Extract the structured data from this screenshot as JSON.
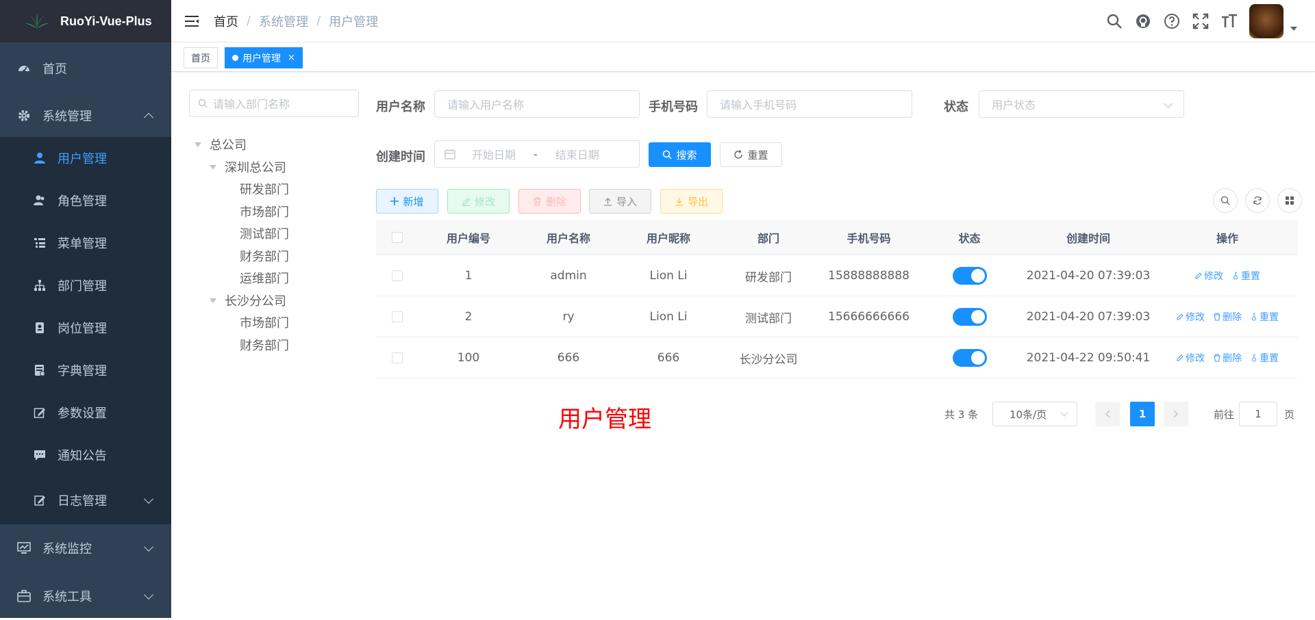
{
  "app": {
    "name": "RuoYi-Vue-Plus"
  },
  "sidebar": {
    "items": [
      {
        "label": "首页",
        "icon": "dashboard-icon"
      },
      {
        "label": "系统管理",
        "icon": "gear-icon",
        "expanded": true
      }
    ],
    "system_sub": [
      {
        "label": "用户管理",
        "icon": "user-icon",
        "active": true
      },
      {
        "label": "角色管理",
        "icon": "peoples-icon"
      },
      {
        "label": "菜单管理",
        "icon": "tree-table-icon"
      },
      {
        "label": "部门管理",
        "icon": "tree-icon"
      },
      {
        "label": "岗位管理",
        "icon": "post-icon"
      },
      {
        "label": "字典管理",
        "icon": "dict-icon"
      },
      {
        "label": "参数设置",
        "icon": "edit-icon"
      },
      {
        "label": "通知公告",
        "icon": "message-icon"
      },
      {
        "label": "日志管理",
        "icon": "log-icon"
      }
    ],
    "bottom": [
      {
        "label": "系统监控",
        "icon": "monitor-icon"
      },
      {
        "label": "系统工具",
        "icon": "tool-icon"
      }
    ]
  },
  "breadcrumb": [
    "首页",
    "系统管理",
    "用户管理"
  ],
  "tags": [
    {
      "label": "首页",
      "active": false
    },
    {
      "label": "用户管理",
      "active": true,
      "close": "×"
    }
  ],
  "dept": {
    "placeholder": "请输入部门名称",
    "tree": {
      "root": "总公司",
      "n1": "深圳总公司",
      "n1c": [
        "研发部门",
        "市场部门",
        "测试部门",
        "财务部门",
        "运维部门"
      ],
      "n2": "长沙分公司",
      "n2c": [
        "市场部门",
        "财务部门"
      ]
    }
  },
  "form": {
    "username_label": "用户名称",
    "username_ph": "请输入用户名称",
    "phone_label": "手机号码",
    "phone_ph": "请输入手机号码",
    "status_label": "状态",
    "status_ph": "用户状态",
    "created_label": "创建时间",
    "start_ph": "开始日期",
    "range_sep": "-",
    "end_ph": "结束日期",
    "search_btn": "搜索",
    "reset_btn": "重置"
  },
  "toolbar": {
    "add": "新增",
    "edit": "修改",
    "delete": "删除",
    "import": "导入",
    "export": "导出"
  },
  "table": {
    "headers": [
      "用户编号",
      "用户名称",
      "用户昵称",
      "部门",
      "手机号码",
      "状态",
      "创建时间",
      "操作"
    ],
    "rows": [
      {
        "id": "1",
        "name": "admin",
        "nick": "Lion Li",
        "dept": "研发部门",
        "phone": "15888888888",
        "status": true,
        "created": "2021-04-20 07:39:03",
        "ops": [
          "修改",
          "重置"
        ]
      },
      {
        "id": "2",
        "name": "ry",
        "nick": "Lion Li",
        "dept": "测试部门",
        "phone": "15666666666",
        "status": true,
        "created": "2021-04-20 07:39:03",
        "ops": [
          "修改",
          "删除",
          "重置"
        ]
      },
      {
        "id": "100",
        "name": "666",
        "nick": "666",
        "dept": "长沙分公司",
        "phone": "",
        "status": true,
        "created": "2021-04-22 09:50:41",
        "ops": [
          "修改",
          "删除",
          "重置"
        ]
      }
    ]
  },
  "pagination": {
    "total": "共 3 条",
    "size": "10条/页",
    "page": "1",
    "goto": "前往",
    "goto_value": "1",
    "page_unit": "页"
  },
  "watermark": "用户管理",
  "colors": {
    "sidebar": "#304156",
    "submenu": "#1f2d3d",
    "primary": "#1890ff",
    "active_text": "#409eff"
  }
}
